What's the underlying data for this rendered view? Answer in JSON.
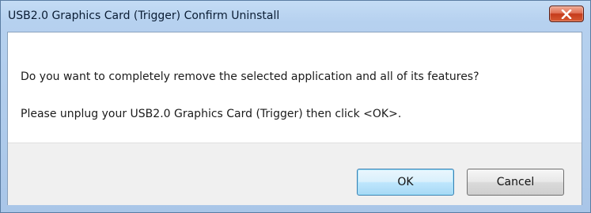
{
  "window": {
    "title": "USB2.0 Graphics Card (Trigger) Confirm Uninstall",
    "close_icon": "close-icon"
  },
  "message": {
    "line1": "Do you want to completely remove the selected application and all of its features?",
    "line2": "Please unplug your USB2.0 Graphics Card (Trigger) then click <OK>."
  },
  "buttons": {
    "ok_label": "OK",
    "cancel_label": "Cancel"
  },
  "colors": {
    "titlebar": "#b6d1ef",
    "close_button": "#c53b1b",
    "footer": "#f0f0f0",
    "default_button": "#bee6fd"
  }
}
